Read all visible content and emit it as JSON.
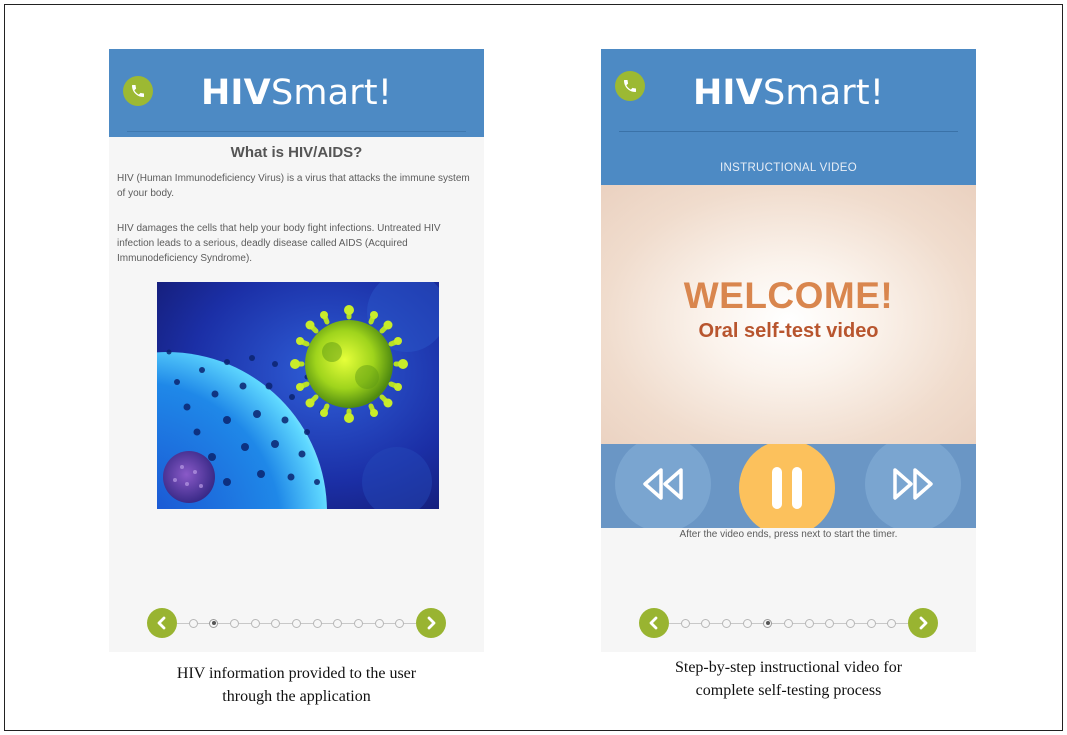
{
  "left_screen": {
    "brand_bold": "HIV",
    "brand_rest": "Smart!",
    "title": "What is HIV/AIDS?",
    "paragraph1": "HIV (Human Immunodeficiency Virus) is a virus that attacks the immune system of your body.",
    "paragraph2": "HIV damages the cells that help your body fight infections. Untreated HIV infection leads to a serious, deadly disease called AIDS (Acquired Immunodeficiency Syndrome).",
    "pager": {
      "total_dots": 11,
      "active_index": 1
    },
    "caption_line1": "HIV information provided to the user",
    "caption_line2": "through the application"
  },
  "right_screen": {
    "brand_bold": "HIV",
    "brand_rest": "Smart!",
    "section_label": "INSTRUCTIONAL VIDEO",
    "welcome": "WELCOME!",
    "subtitle": "Oral self-test video",
    "hint": "After the video ends, press next to start the timer.",
    "pager": {
      "total_dots": 11,
      "active_index": 4
    },
    "caption_line1": "Step-by-step instructional video for",
    "caption_line2": "complete self-testing process"
  },
  "icons": {
    "call": "phone-icon",
    "prev": "chevron-left-icon",
    "next": "chevron-right-icon",
    "rewind": "rewind-icon",
    "pause": "pause-icon",
    "forward": "fast-forward-icon"
  },
  "colors": {
    "header_blue": "#4d8ac4",
    "accent_green": "#99b431",
    "controls_blue": "#6a96c5",
    "pause_yellow": "#fcc15c",
    "welcome_orange": "#d9864e"
  }
}
